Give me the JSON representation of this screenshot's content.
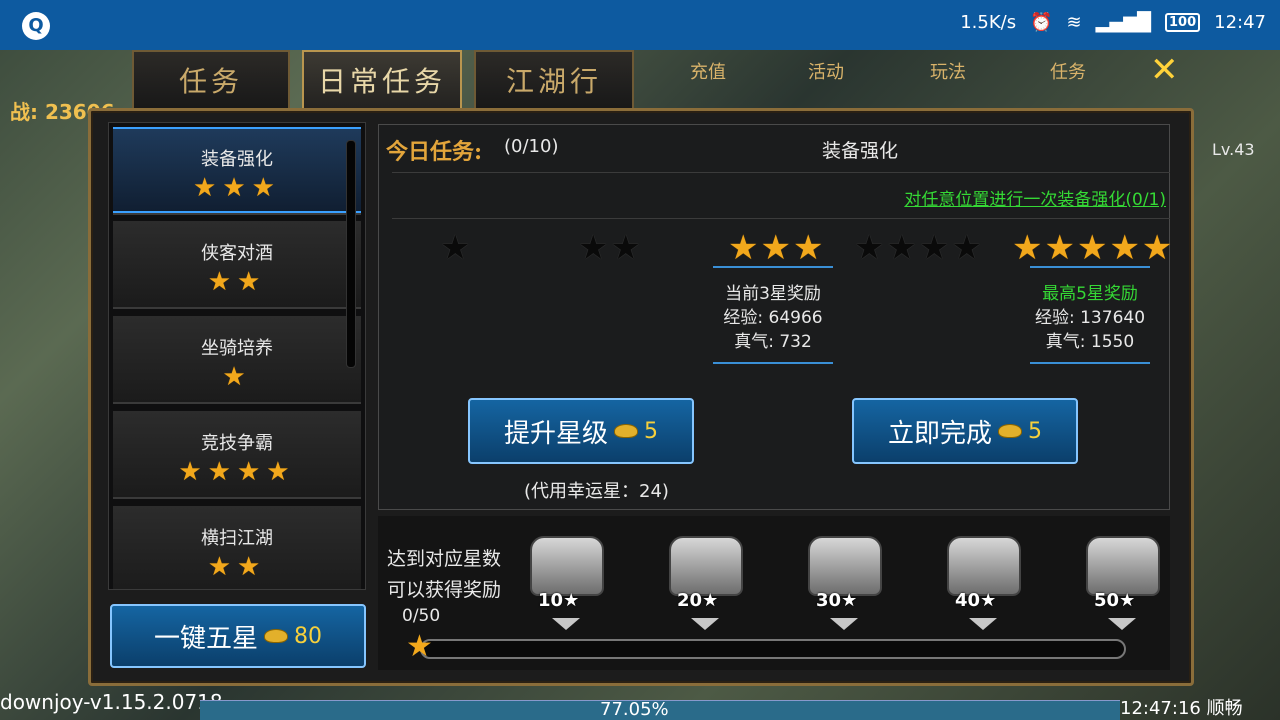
{
  "status_bar": {
    "speed": "1.5K/s",
    "battery": "100",
    "time": "12:47"
  },
  "tabs": [
    {
      "label": "任务",
      "active": false
    },
    {
      "label": "日常任务",
      "active": true
    },
    {
      "label": "江湖行",
      "active": false
    }
  ],
  "hud": {
    "power": "战: 23606",
    "level": "Lv.43",
    "version": "downjoy-v1.15.2.0718",
    "progress_text": "77.05%",
    "clock": "12:47:16",
    "net": "顺畅"
  },
  "bg_menu": [
    "充值",
    "活动",
    "玩法",
    "任务"
  ],
  "sidebar": {
    "items": [
      {
        "name": "装备强化",
        "stars": "★★★",
        "active": true
      },
      {
        "name": "侠客对酒",
        "stars": "★★",
        "active": false
      },
      {
        "name": "坐骑培养",
        "stars": "★",
        "active": false
      },
      {
        "name": "竞技争霸",
        "stars": "★★★★",
        "active": false
      },
      {
        "name": "横扫江湖",
        "stars": "★★",
        "active": false
      }
    ],
    "one_click_label": "一键五星",
    "one_click_cost": "80"
  },
  "task": {
    "today_label": "今日任务:",
    "today_count": "(0/10)",
    "title": "装备强化",
    "goal": "对任意位置进行一次装备强化(0/1)"
  },
  "star_levels": [
    {
      "stars": "★",
      "gold": false
    },
    {
      "stars": "★★",
      "gold": false
    },
    {
      "stars": "★★★",
      "gold": true
    },
    {
      "stars": "★★★★",
      "gold": false
    },
    {
      "stars": "★★★★★",
      "gold": true
    }
  ],
  "rewards": {
    "current": {
      "title": "当前3星奖励",
      "exp": "经验: 64966",
      "qi": "真气: 732"
    },
    "max": {
      "title": "最高5星奖励",
      "exp": "经验: 137640",
      "qi": "真气: 1550"
    }
  },
  "buttons": {
    "upgrade_label": "提升星级",
    "upgrade_cost": "5",
    "complete_label": "立即完成",
    "complete_cost": "5",
    "lucky_text": "(代用幸运星：24)"
  },
  "star_rewards": {
    "label": "达到对应星数可以获得奖励",
    "progress": "0/50",
    "progress_fraction": 0.0,
    "chests": [
      "10",
      "20",
      "30",
      "40",
      "50"
    ]
  }
}
